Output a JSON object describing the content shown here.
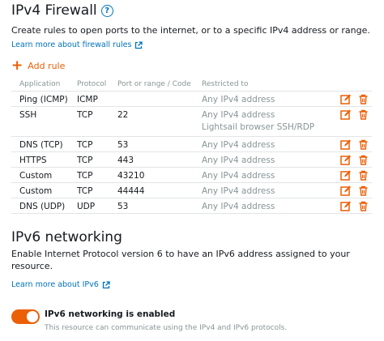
{
  "ipv4": {
    "title": "IPv4 Firewall",
    "help": "?",
    "description": "Create rules to open ports to the internet, or to a specific IPv4 address or range.",
    "learn_more": "Learn more about firewall rules",
    "add_rule": "Add rule",
    "columns": [
      "Application",
      "Protocol",
      "Port or range / Code",
      "Restricted to"
    ],
    "rules": [
      {
        "application": "Ping (ICMP)",
        "protocol": "ICMP",
        "port": "",
        "restricted": "Any IPv4 address",
        "restricted_sub": ""
      },
      {
        "application": "SSH",
        "protocol": "TCP",
        "port": "22",
        "restricted": "Any IPv4 address",
        "restricted_sub": "Lightsail browser SSH/RDP"
      },
      {
        "application": "DNS (TCP)",
        "protocol": "TCP",
        "port": "53",
        "restricted": "Any IPv4 address",
        "restricted_sub": ""
      },
      {
        "application": "HTTPS",
        "protocol": "TCP",
        "port": "443",
        "restricted": "Any IPv4 address",
        "restricted_sub": ""
      },
      {
        "application": "Custom",
        "protocol": "TCP",
        "port": "43210",
        "restricted": "Any IPv4 address",
        "restricted_sub": ""
      },
      {
        "application": "Custom",
        "protocol": "TCP",
        "port": "44444",
        "restricted": "Any IPv4 address",
        "restricted_sub": ""
      },
      {
        "application": "DNS (UDP)",
        "protocol": "UDP",
        "port": "53",
        "restricted": "Any IPv4 address",
        "restricted_sub": ""
      }
    ]
  },
  "ipv6": {
    "title": "IPv6 networking",
    "description_line1": "Enable Internet Protocol version 6 to have an IPv6 address assigned to your",
    "description_line2": "resource.",
    "learn_more": "Learn more about IPv6",
    "toggle_label": "IPv6 networking is enabled",
    "toggle_description": "This resource can communicate using the IPv4 and IPv6 protocols.",
    "toggle_on": true
  },
  "colors": {
    "accent": "#eb5f07",
    "link": "#0073bb",
    "muted": "#879596"
  }
}
